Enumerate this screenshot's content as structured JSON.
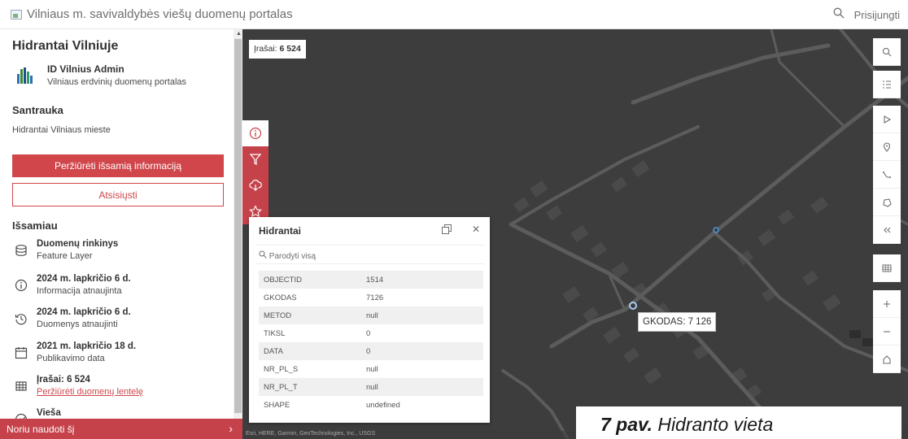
{
  "header": {
    "title": "Vilniaus m. savivaldybės viešų duomenų portalas",
    "signin": "Prisijungti"
  },
  "sidebar": {
    "title": "Hidrantai Vilniuje",
    "owner": {
      "name": "ID Vilnius Admin",
      "org": "Vilniaus erdvinių duomenų portalas"
    },
    "summary_heading": "Santrauka",
    "summary_text": "Hidrantai Vilniaus mieste",
    "btn_details": "Peržiūrėti išsamią informaciją",
    "btn_download": "Atsisiųsti",
    "details_heading": "Išsamiau",
    "details": [
      {
        "icon": "database-icon",
        "title": "Duomenų rinkinys",
        "sub": "Feature Layer"
      },
      {
        "icon": "info-icon",
        "title": "2024 m. lapkričio 6 d.",
        "sub": "Informacija atnaujinta"
      },
      {
        "icon": "history-icon",
        "title": "2024 m. lapkričio 6 d.",
        "sub": "Duomenys atnaujinti"
      },
      {
        "icon": "calendar-icon",
        "title": "2021 m. lapkričio 18 d.",
        "sub": "Publikavimo data"
      },
      {
        "icon": "table-icon",
        "title": "Įrašai: 6 524",
        "sub": "Peržiūrėti duomenų lentelę"
      },
      {
        "icon": "globe-icon",
        "title": "Vieša",
        "sub": ""
      }
    ],
    "use_bar": "Noriu naudoti šį"
  },
  "map": {
    "count_label": "Įrašai:",
    "count_value": "6 524",
    "attribution": "Esri, HERE, Garmin, GeoTechnologies, Inc., USGS",
    "tooltip": "GKODAS: 7 126"
  },
  "popup": {
    "title": "Hidrantai",
    "zoom_label": "Parodyti visą",
    "rows": [
      {
        "k": "OBJECTID",
        "v": "1514"
      },
      {
        "k": "GKODAS",
        "v": "7126"
      },
      {
        "k": "METOD",
        "v": "null"
      },
      {
        "k": "TIKSL",
        "v": "0"
      },
      {
        "k": "DATA",
        "v": "0"
      },
      {
        "k": "NR_PL_S",
        "v": "null"
      },
      {
        "k": "NR_PL_T",
        "v": "null"
      },
      {
        "k": "SHAPE",
        "v": "undefined"
      }
    ]
  },
  "caption": {
    "num": "7 pav.",
    "text": "Hidranto vieta"
  },
  "colors": {
    "accent": "#d0464b",
    "map_bg": "#3d3d3d"
  }
}
